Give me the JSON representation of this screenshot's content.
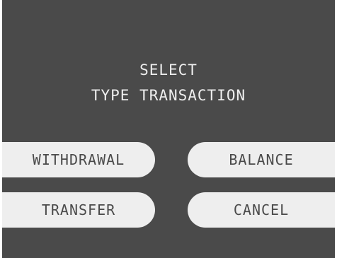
{
  "prompt": {
    "line1": "SELECT",
    "line2": "TYPE TRANSACTION"
  },
  "options": {
    "withdrawal": "WITHDRAWAL",
    "balance": "BALANCE",
    "transfer": "TRANSFER",
    "cancel": "CANCEL"
  },
  "colors": {
    "screen_background": "#4a4a4a",
    "button_background": "#eeeeee",
    "button_text": "#4a4a4a",
    "prompt_text": "#eeeeee"
  }
}
